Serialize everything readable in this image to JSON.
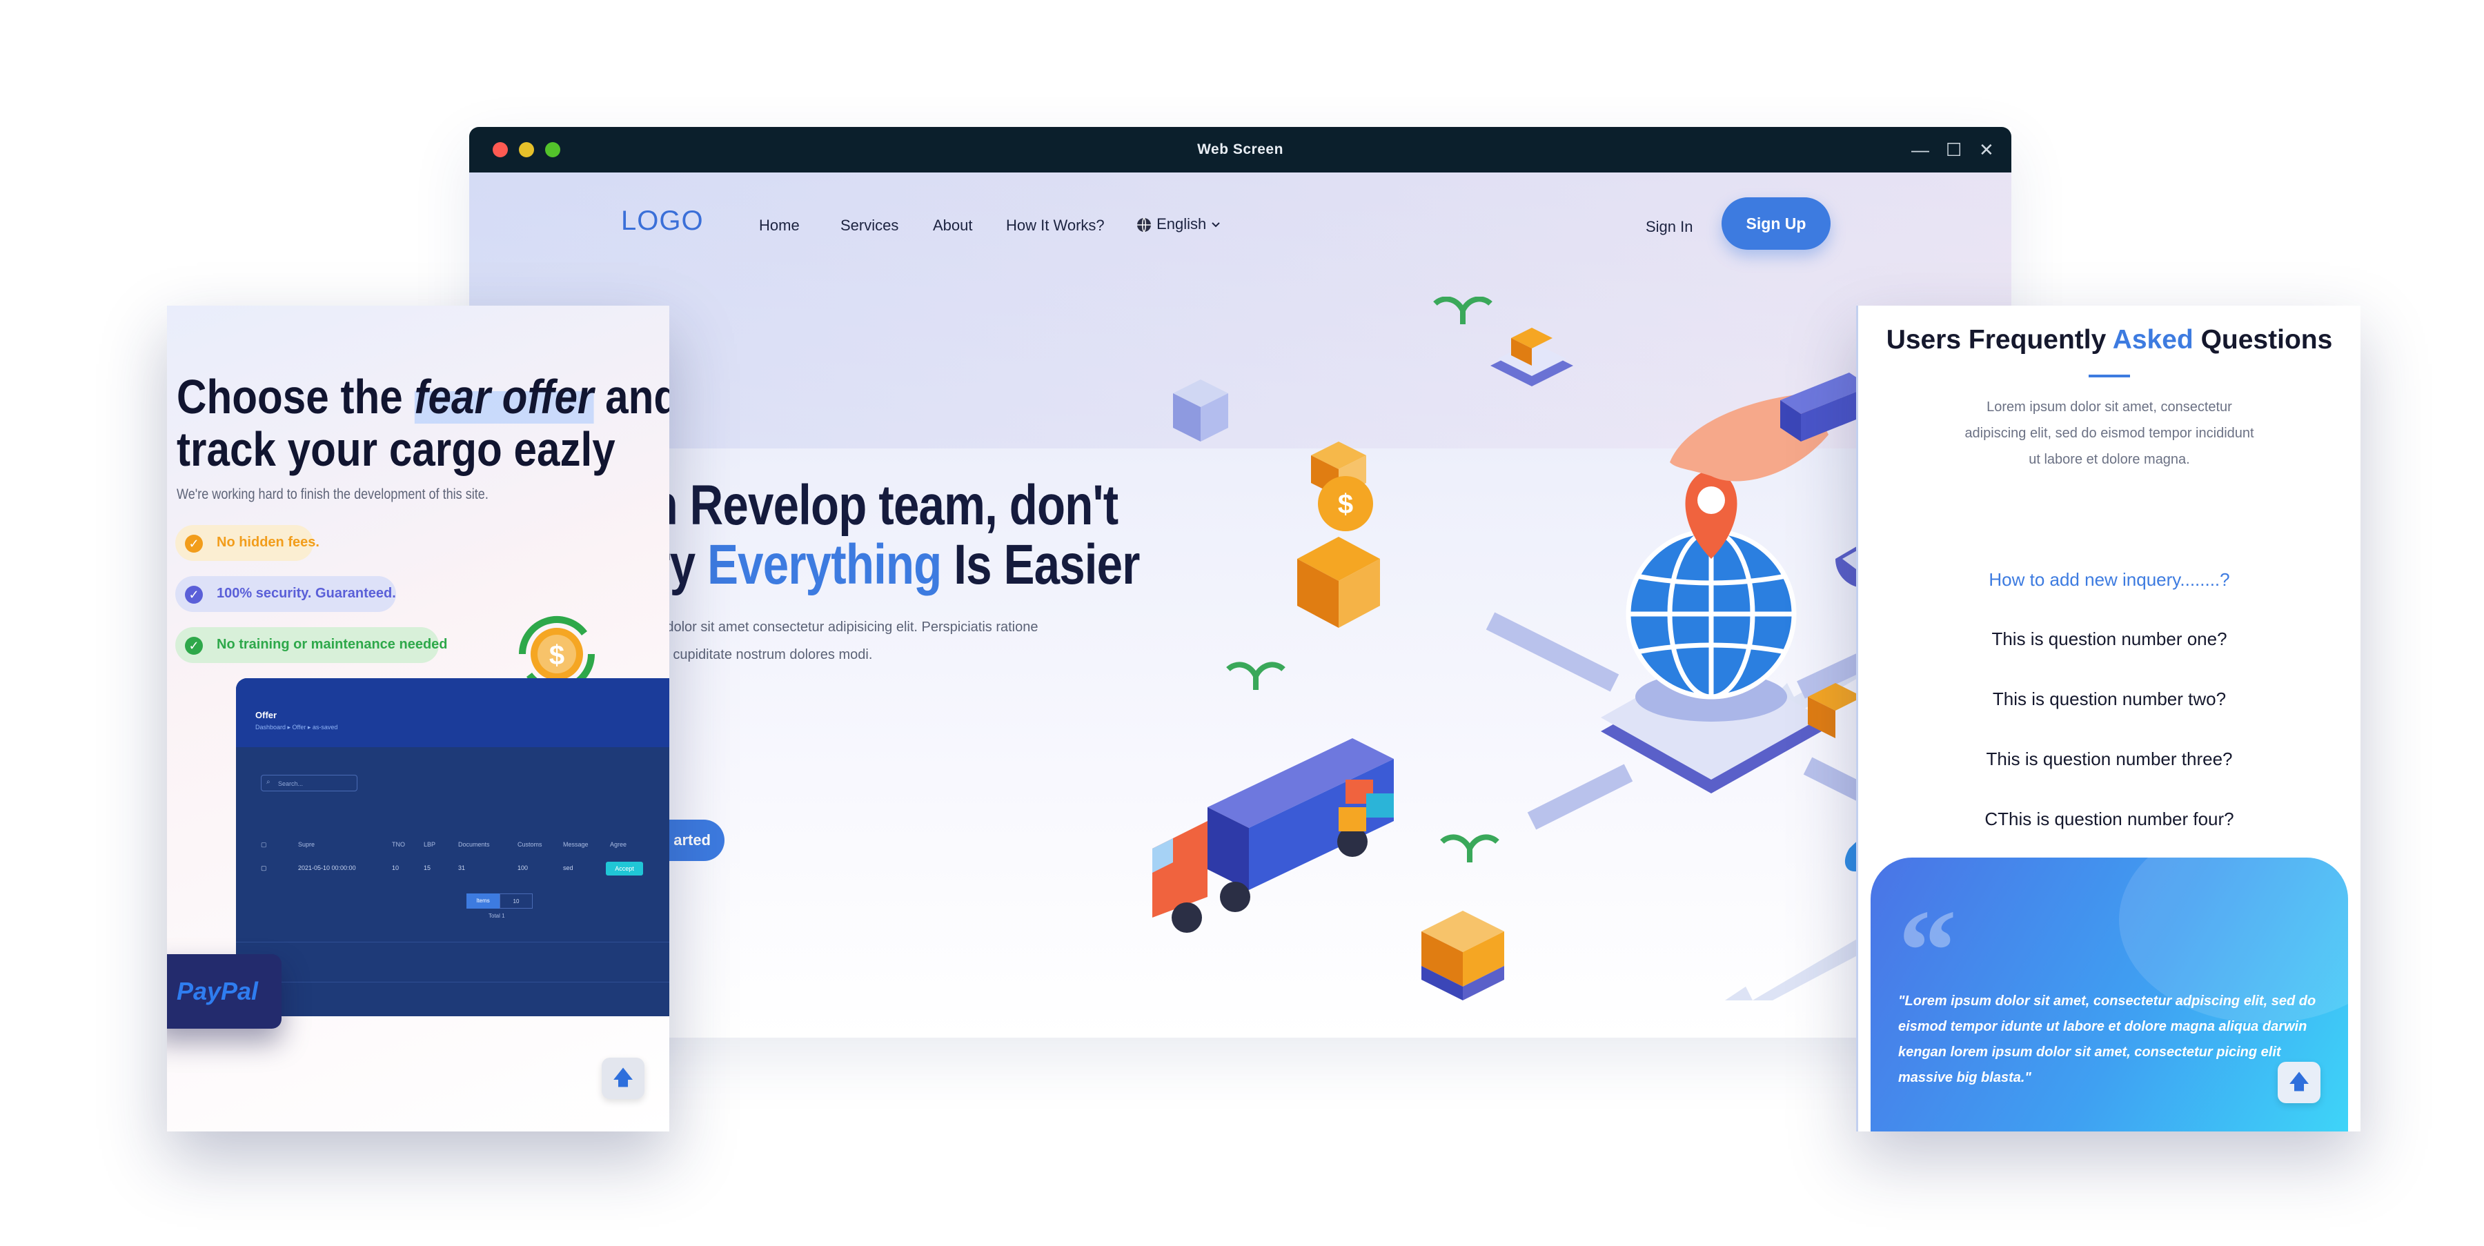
{
  "window": {
    "title": "Web Screen",
    "controls": {
      "minimize": "—",
      "maximize": "☐",
      "close": "✕"
    }
  },
  "header": {
    "logo": "LOGO",
    "nav": [
      {
        "label": "Home"
      },
      {
        "label": "Services"
      },
      {
        "label": "About"
      },
      {
        "label": "How It Works?"
      }
    ],
    "language": "English",
    "sign_in": "Sign In",
    "sign_up": "Sign Up"
  },
  "hero": {
    "line1": "th Revelop team, don't",
    "line2_a": "rry ",
    "line2_highlight": "Everything",
    "line2_b": " Is Easier",
    "para1": "sum dolor sit amet consectetur adipisicing elit. Perspiciatis ratione",
    "para2": "tibus, cupiditate nostrum dolores modi.",
    "cta": "arted"
  },
  "left_card": {
    "title1_a": "Choose the ",
    "title1_italic": "fear offer",
    "title1_b": " and",
    "title2": "track your cargo eazly",
    "subtitle": "We're working hard to finish the development of this site.",
    "features": [
      {
        "label": "No hidden fees.",
        "color": "#f29d1b",
        "bg": "#fbeed2"
      },
      {
        "label": "100% security. Guaranteed.",
        "color": "#5a5fd8",
        "bg": "#dde1f8"
      },
      {
        "label": "No training or maintenance needed",
        "color": "#2ea84a",
        "bg": "#d8f0d9"
      }
    ],
    "dashboard": {
      "title": "Offer",
      "breadcrumb": "Dashboard  ▸  Offer  ▸  as-saved",
      "search_placeholder": "Search...",
      "columns": [
        "Supre",
        "TNO",
        "LBP",
        "Documents",
        "Customs",
        "Message",
        "Agree"
      ],
      "row": [
        "2021-05-10 00:00:00",
        "10",
        "15",
        "31",
        "100",
        "sed"
      ],
      "accept": "Accept",
      "pager": [
        "Items",
        "10"
      ],
      "total": "Total 1"
    },
    "paypal": "PayPal"
  },
  "right_card": {
    "title_a": "Users Frequently ",
    "title_highlight": "Asked",
    "title_b": " Questions",
    "desc": [
      "Lorem ipsum dolor sit amet, consectetur",
      "adipiscing elit, sed do eismod tempor incididunt",
      "ut labore et dolore magna."
    ],
    "questions": [
      "How to add new inquery........?",
      "This is question number one?",
      "This is question number two?",
      "This is question number three?",
      "CThis is question number four?"
    ],
    "testimonial": "\"Lorem ipsum dolor sit amet, consectetur adpiscing elit, sed do eismod tempor idunte ut labore et dolore magna aliqua darwin kengan lorem ipsum dolor sit amet, consectetur picing elit massive big blasta.\""
  },
  "icons": {
    "globe": "globe-icon",
    "chevron": "chevron-down-icon",
    "check": "check-icon",
    "up": "arrow-up-icon",
    "quote": "quote-icon"
  },
  "colors": {
    "accent": "#3d7be0",
    "dark": "#0b1f2c",
    "heading": "#151b3d"
  }
}
